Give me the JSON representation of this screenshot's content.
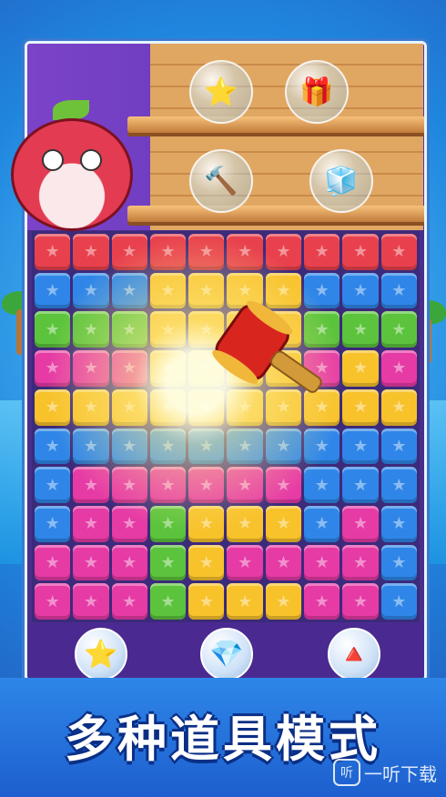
{
  "colors": {
    "red": "#e8414d",
    "blue": "#2f86e8",
    "yellow": "#f8c22b",
    "green": "#5cc33c",
    "pink": "#e63aa5",
    "purple": "#8a2fd0"
  },
  "shelf_items": [
    {
      "icon": "star-bubble-icon",
      "glyph": "⭐"
    },
    {
      "icon": "gift-bubble-icon",
      "glyph": "🎁"
    },
    {
      "icon": "hammer-bubble-icon",
      "glyph": "🔨"
    },
    {
      "icon": "blocks-bubble-icon",
      "glyph": "🧊"
    }
  ],
  "board": [
    [
      "red",
      "red",
      "red",
      "red",
      "red",
      "red",
      "red",
      "red",
      "red",
      "red"
    ],
    [
      "blue",
      "blue",
      "blue",
      "yellow",
      "yellow",
      "yellow",
      "yellow",
      "blue",
      "blue",
      "blue"
    ],
    [
      "green",
      "green",
      "green",
      "yellow",
      "yellow",
      "yellow",
      "yellow",
      "green",
      "green",
      "green"
    ],
    [
      "pink",
      "pink",
      "pink",
      "yellow",
      "yellow",
      "yellow",
      "yellow",
      "pink",
      "yellow",
      "pink"
    ],
    [
      "yellow",
      "yellow",
      "yellow",
      "yellow",
      "yellow",
      "yellow",
      "yellow",
      "yellow",
      "yellow",
      "yellow"
    ],
    [
      "blue",
      "blue",
      "blue",
      "blue",
      "blue",
      "blue",
      "blue",
      "blue",
      "blue",
      "blue"
    ],
    [
      "blue",
      "pink",
      "pink",
      "pink",
      "pink",
      "pink",
      "pink",
      "blue",
      "blue",
      "blue"
    ],
    [
      "blue",
      "pink",
      "pink",
      "green",
      "yellow",
      "yellow",
      "yellow",
      "blue",
      "pink",
      "blue"
    ],
    [
      "pink",
      "pink",
      "pink",
      "green",
      "yellow",
      "pink",
      "pink",
      "pink",
      "pink",
      "blue"
    ],
    [
      "pink",
      "pink",
      "pink",
      "green",
      "yellow",
      "yellow",
      "yellow",
      "pink",
      "pink",
      "blue"
    ]
  ],
  "tools": [
    {
      "icon": "star-tool-icon",
      "glyph": "⭐"
    },
    {
      "icon": "diamond-tool-icon",
      "glyph": "💎"
    },
    {
      "icon": "heart-tool-icon",
      "glyph": "🔺"
    }
  ],
  "banner": {
    "title": "多种道具模式"
  },
  "watermark": {
    "logo": "听",
    "text": "一听下载"
  }
}
